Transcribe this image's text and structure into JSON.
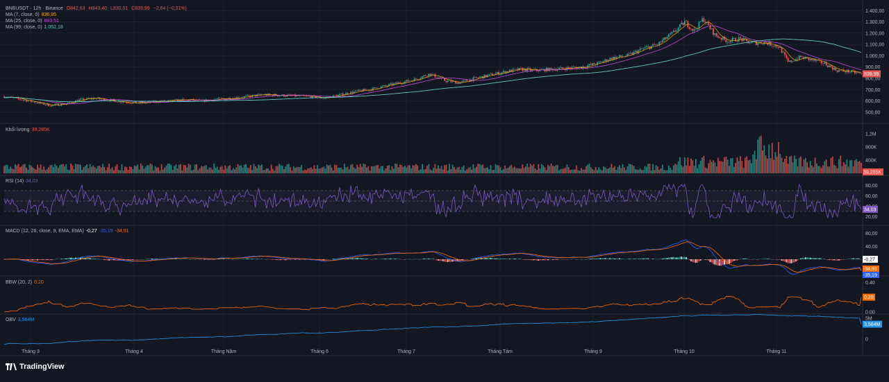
{
  "header": {
    "symbol": "BNBUSDT · 12h · Binance",
    "open": "O842,63",
    "high": "H843,40",
    "low": "L830,01",
    "close": "C839,99",
    "change": "−2,64 (−0,31%)",
    "ma7_label": "MA (7, close, 0)",
    "ma7_value": "836,95",
    "ma25_label": "MA (25, close, 0)",
    "ma25_value": "893,51",
    "ma99_label": "MA (99, close, 0)",
    "ma99_value": "1.052,18"
  },
  "panes": {
    "volume": {
      "label": "Khối lượng",
      "value": "39,285K",
      "badge": "39,285K"
    },
    "rsi": {
      "label": "RSI (14)",
      "value": "34,03",
      "badge": "34,03"
    },
    "macd": {
      "label": "MACD (12, 26, close, 9, EMA, EMA)",
      "hist": "-0,27",
      "macd": "-35,19",
      "signal": "-34,91"
    },
    "bbw": {
      "label": "BBW (20, 2)",
      "value": "0.20",
      "badge": "0.20"
    },
    "obv": {
      "label": "OBV",
      "value": "3,564M",
      "badge": "3,564M"
    }
  },
  "price_badge": "839,99",
  "brand": "TradingView",
  "colors": {
    "up": "#26a69a",
    "down": "#ef5350",
    "ma7": "#f7a600",
    "ma25": "#c34bd9",
    "ma99": "#5fc9bd",
    "rsi": "#7e57c2",
    "macd": "#2962ff",
    "signal": "#ff6d00",
    "bbw": "#ff6d00",
    "obv": "#2196f3"
  },
  "chart_data": {
    "type": "candlestick",
    "timeframe": "12h",
    "x_ticks": [
      "Tháng 3",
      "Tháng 4",
      "Tháng Năm",
      "Tháng 6",
      "Tháng 7",
      "Tháng Tám",
      "Tháng 9",
      "Tháng 10",
      "Tháng 11"
    ],
    "price_ticks": [
      "1.400,00",
      "1.300,00",
      "1.200,00",
      "1.100,00",
      "1.000,00",
      "900,00",
      "800,00",
      "700,00",
      "600,00",
      "500,00"
    ],
    "volume_ticks": [
      "1,2M",
      "800K",
      "400K"
    ],
    "rsi_ticks": [
      "80,00",
      "60,00",
      "40,00",
      "20,00"
    ],
    "macd_ticks": [
      "80,00",
      "40,00",
      "0,00"
    ],
    "bbw_ticks": [
      "0.40",
      "0.00"
    ],
    "obv_ticks": [
      "5M",
      "0"
    ],
    "close_path": [
      [
        0,
        640
      ],
      [
        5,
        615
      ],
      [
        10,
        590
      ],
      [
        15,
        560
      ],
      [
        20,
        575
      ],
      [
        25,
        610
      ],
      [
        30,
        625
      ],
      [
        35,
        605
      ],
      [
        40,
        590
      ],
      [
        45,
        580
      ],
      [
        50,
        595
      ],
      [
        55,
        600
      ],
      [
        60,
        610
      ],
      [
        65,
        600
      ],
      [
        70,
        615
      ],
      [
        75,
        625
      ],
      [
        80,
        640
      ],
      [
        85,
        655
      ],
      [
        90,
        650
      ],
      [
        95,
        645
      ],
      [
        100,
        640
      ],
      [
        105,
        625
      ],
      [
        110,
        650
      ],
      [
        115,
        680
      ],
      [
        120,
        700
      ],
      [
        125,
        730
      ],
      [
        130,
        760
      ],
      [
        135,
        790
      ],
      [
        140,
        840
      ],
      [
        145,
        780
      ],
      [
        150,
        760
      ],
      [
        155,
        800
      ],
      [
        160,
        830
      ],
      [
        165,
        860
      ],
      [
        170,
        880
      ],
      [
        175,
        870
      ],
      [
        180,
        880
      ],
      [
        185,
        890
      ],
      [
        190,
        900
      ],
      [
        195,
        930
      ],
      [
        200,
        980
      ],
      [
        205,
        1000
      ],
      [
        210,
        1060
      ],
      [
        215,
        1100
      ],
      [
        220,
        1200
      ],
      [
        224,
        1300
      ],
      [
        227,
        1220
      ],
      [
        230,
        1330
      ],
      [
        234,
        1180
      ],
      [
        238,
        1130
      ],
      [
        242,
        1150
      ],
      [
        246,
        1110
      ],
      [
        250,
        1120
      ],
      [
        255,
        1080
      ],
      [
        258,
        940
      ],
      [
        262,
        990
      ],
      [
        266,
        960
      ],
      [
        270,
        930
      ],
      [
        274,
        870
      ],
      [
        278,
        860
      ],
      [
        282,
        840
      ]
    ],
    "ma7_last": 836.95,
    "ma25_last": 893.51,
    "ma99_last": 1052.18,
    "last_close": 839.99,
    "volume_last": 39285,
    "rsi_last": 34.03,
    "macd_last": -35.19,
    "signal_last": -34.91,
    "hist_last": -0.27,
    "bbw_last": 0.2,
    "obv_last": 3564000
  }
}
